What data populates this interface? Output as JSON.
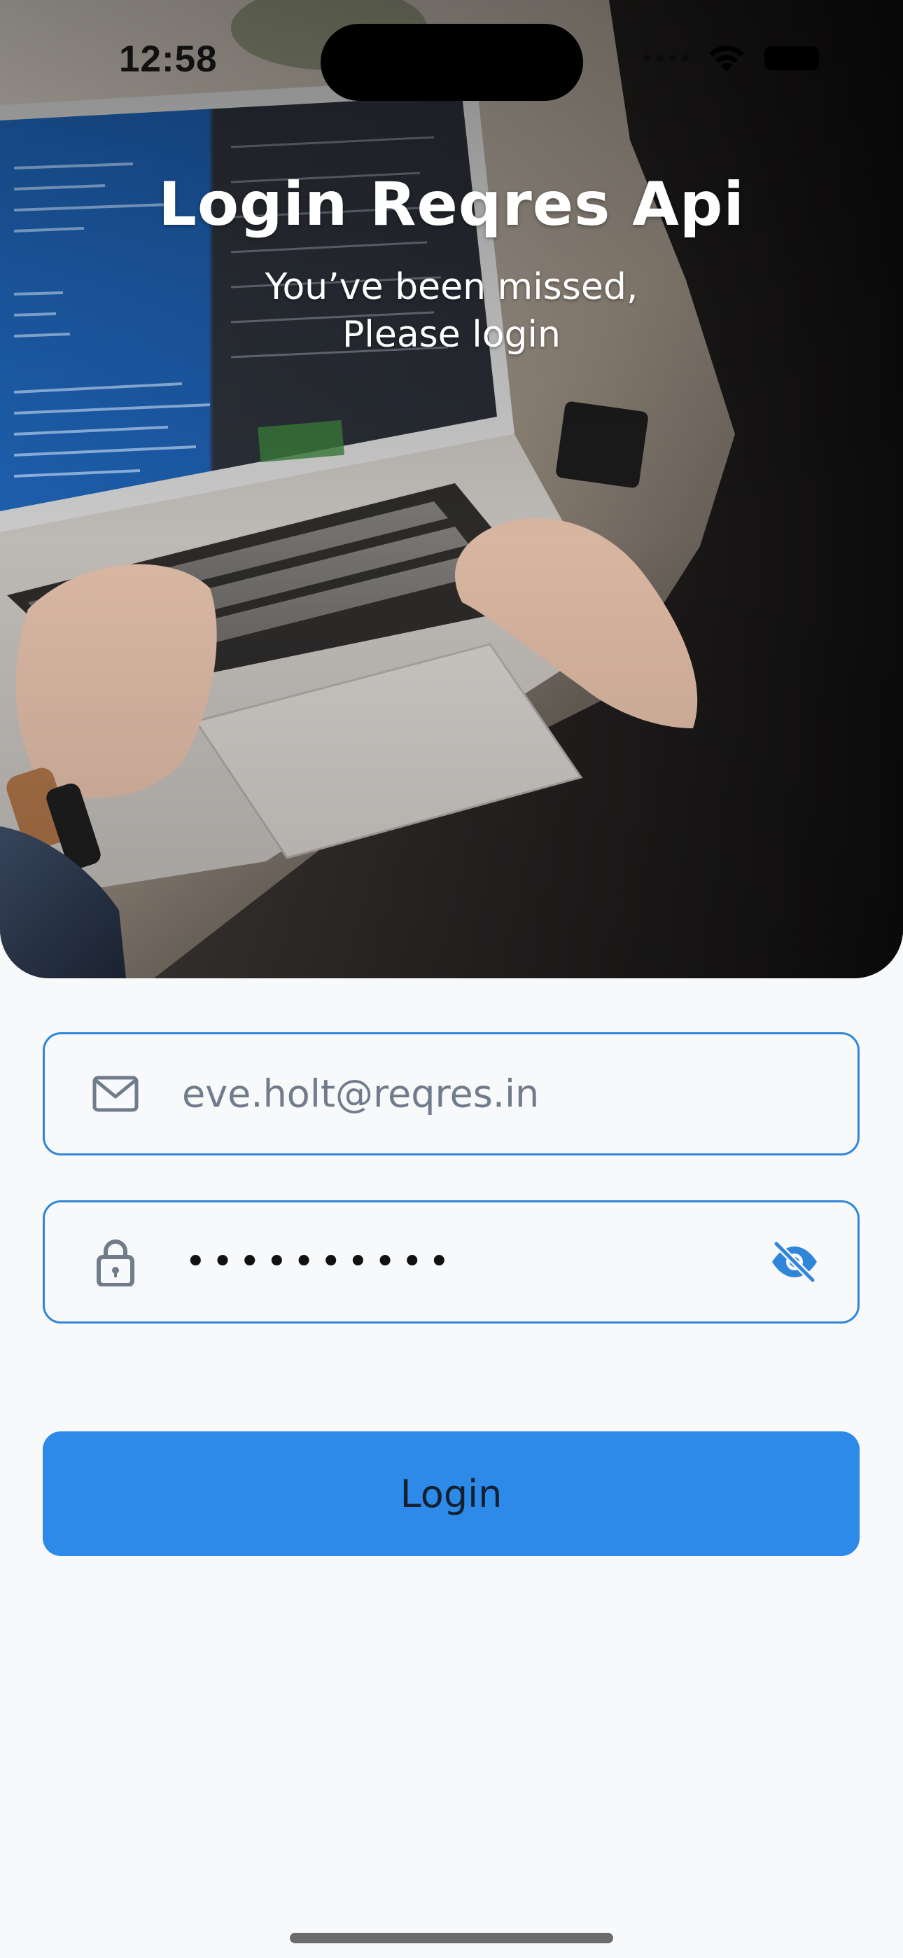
{
  "status_bar": {
    "time": "12:58"
  },
  "hero": {
    "title": "Login Reqres Api",
    "subtitle_line1": "You’ve been missed,",
    "subtitle_line2": "Please login"
  },
  "form": {
    "email": {
      "icon": "mail-icon",
      "value": "eve.holt@reqres.in"
    },
    "password": {
      "icon": "lock-icon",
      "value": "••••••••••",
      "visibility_icon": "eye-off-icon"
    },
    "login_label": "Login"
  },
  "colors": {
    "accent": "#2f86d8",
    "button": "#2d8ae8",
    "background": "#f8f9fa"
  }
}
